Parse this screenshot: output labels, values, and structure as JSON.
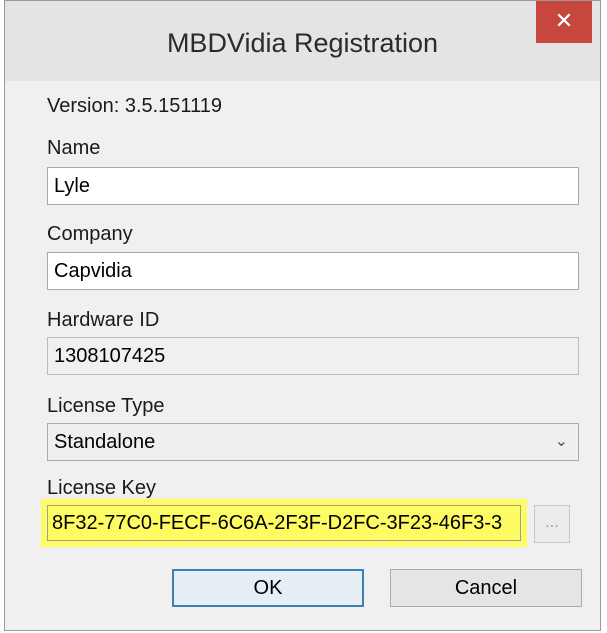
{
  "window": {
    "title": "MBDVidia Registration",
    "close_glyph": "✕"
  },
  "form": {
    "version_text": "Version: 3.5.151119",
    "name_label": "Name",
    "name_value": "Lyle",
    "company_label": "Company",
    "company_value": "Capvidia",
    "hardware_id_label": "Hardware ID",
    "hardware_id_value": "1308107425",
    "license_type_label": "License Type",
    "license_type_value": "Standalone",
    "license_key_label": "License Key",
    "license_key_value": "8F32-77C0-FECF-6C6A-2F3F-D2FC-3F23-46F3-3",
    "browse_label": "...",
    "highlight_color": "#fffb63"
  },
  "buttons": {
    "ok_label": "OK",
    "cancel_label": "Cancel"
  }
}
